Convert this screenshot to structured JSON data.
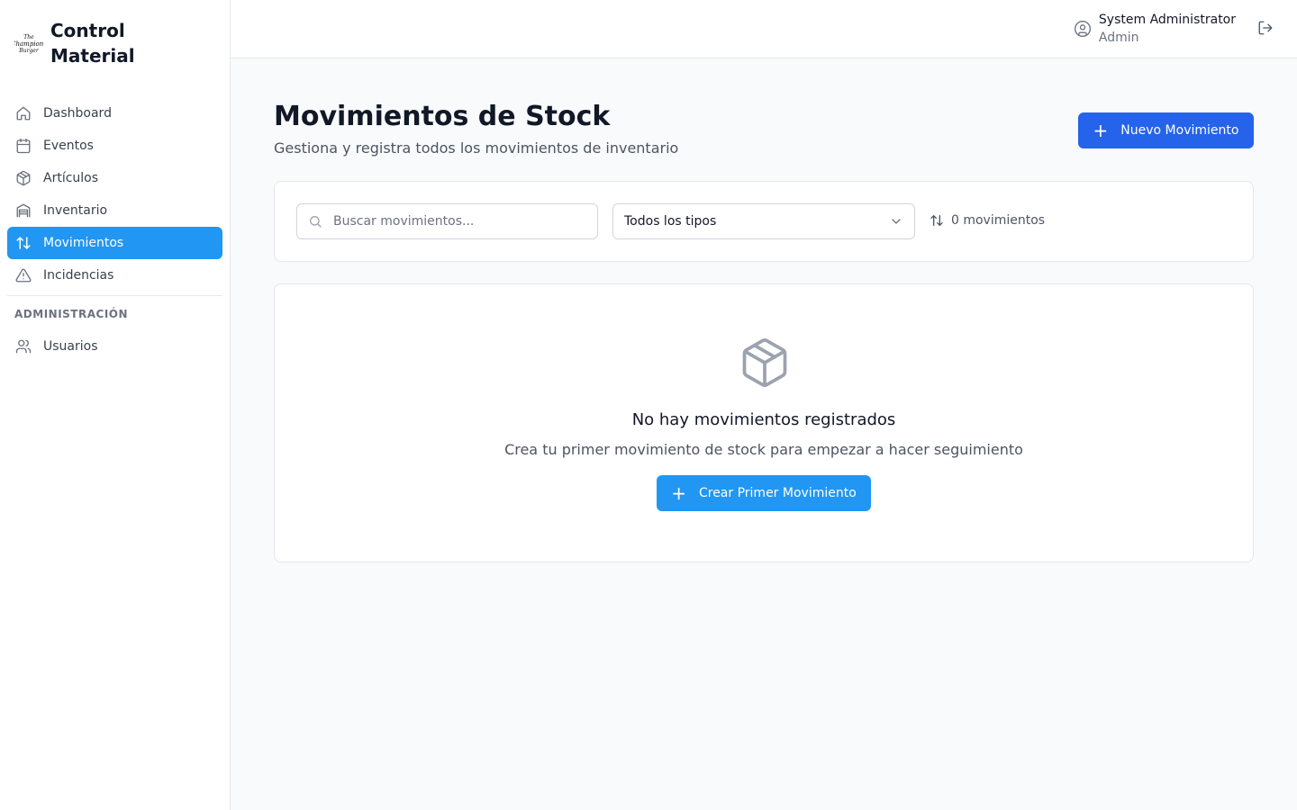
{
  "brand": {
    "logo_text": "The Champions Burger",
    "title": "Control Material"
  },
  "sidebar": {
    "items": [
      {
        "label": "Dashboard",
        "icon": "home-icon",
        "active": false
      },
      {
        "label": "Eventos",
        "icon": "calendar-icon",
        "active": false
      },
      {
        "label": "Artículos",
        "icon": "package-icon",
        "active": false
      },
      {
        "label": "Inventario",
        "icon": "warehouse-icon",
        "active": false
      },
      {
        "label": "Movimientos",
        "icon": "arrows-up-down-icon",
        "active": true
      },
      {
        "label": "Incidencias",
        "icon": "alert-triangle-icon",
        "active": false
      }
    ],
    "section_label": "Administración",
    "admin_items": [
      {
        "label": "Usuarios",
        "icon": "users-icon",
        "active": false
      }
    ]
  },
  "header": {
    "user_name": "System Administrator",
    "user_role": "Admin",
    "user_icon": "user-circle-icon",
    "logout_icon": "logout-icon"
  },
  "main": {
    "title": "Movimientos de Stock",
    "subtitle": "Gestiona y registra todos los movimientos de inventario",
    "new_button": {
      "icon": "plus-icon",
      "label": "Nuevo Movimiento"
    },
    "filters": {
      "search_placeholder": "Buscar movimientos...",
      "search_value": "",
      "type_select": "Todos los tipos",
      "count_label": "0 movimientos"
    },
    "empty_state": {
      "icon": "package-icon",
      "title": "No hay movimientos registrados",
      "text": "Crea tu primer movimiento de stock para empezar a hacer seguimiento",
      "button_label": "Crear Primer Movimiento"
    }
  },
  "colors": {
    "accent": "#2196f3",
    "primary_button": "#2563eb",
    "background": "#f9fafb"
  }
}
